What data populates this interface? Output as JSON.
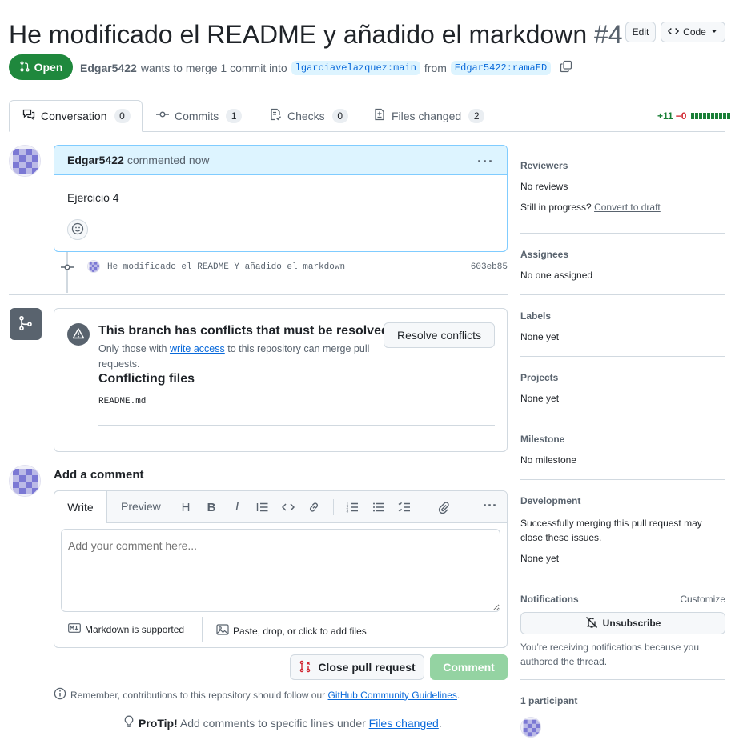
{
  "pr": {
    "title": "He modificado el README y añadido el markdown",
    "number": "#4",
    "edit_label": "Edit",
    "code_label": "Code",
    "state_label": "Open",
    "author": "Edgar5422",
    "merge_text": "wants to merge 1 commit into",
    "base_branch": "lgarciavelazquez:main",
    "from_text": "from",
    "head_branch": "Edgar5422:ramaED"
  },
  "tabs": [
    {
      "label": "Conversation",
      "count": "0"
    },
    {
      "label": "Commits",
      "count": "1"
    },
    {
      "label": "Checks",
      "count": "0"
    },
    {
      "label": "Files changed",
      "count": "2"
    }
  ],
  "diffstat": {
    "additions": "+11",
    "deletions": "−0",
    "blocks": [
      "green",
      "green",
      "green",
      "green",
      "green",
      "green",
      "green",
      "green",
      "green",
      "green"
    ]
  },
  "comment": {
    "author": "Edgar5422",
    "meta": "commented now",
    "body": "Ejercicio 4"
  },
  "commit": {
    "message": "He modificado el README Y añadido el markdown",
    "sha": "603eb85"
  },
  "merge_box": {
    "conflict_title": "This branch has conflicts that must be resolved",
    "conflict_desc_pre": "Only those with",
    "conflict_link": "write access",
    "conflict_desc_post": "to this repository can merge pull requests.",
    "resolve_label": "Resolve conflicts",
    "files_heading": "Conflicting files",
    "files": [
      "README.md"
    ]
  },
  "add_comment": {
    "heading": "Add a comment",
    "tab_write": "Write",
    "tab_preview": "Preview",
    "placeholder": "Add your comment here...",
    "markdown_note": "Markdown is supported",
    "attach_note": "Paste, drop, or click to add files",
    "close_pr_label": "Close pull request",
    "comment_label": "Comment"
  },
  "footer": {
    "guidelines_pre": "Remember, contributions to this repository should follow our",
    "guidelines_link": "GitHub Community Guidelines",
    "guidelines_post": ".",
    "protip_label": "ProTip!",
    "protip_pre": "Add comments to specific lines under",
    "protip_link": "Files changed",
    "protip_post": "."
  },
  "sidebar": {
    "reviewers_heading": "Reviewers",
    "reviewers_value": "No reviews",
    "in_progress": "Still in progress?",
    "convert_draft": "Convert to draft",
    "assignees_heading": "Assignees",
    "assignees_value": "No one assigned",
    "labels_heading": "Labels",
    "labels_value": "None yet",
    "projects_heading": "Projects",
    "projects_value": "None yet",
    "milestone_heading": "Milestone",
    "milestone_value": "No milestone",
    "development_heading": "Development",
    "development_desc": "Successfully merging this pull request may close these issues.",
    "development_value": "None yet",
    "notifications_heading": "Notifications",
    "customize_label": "Customize",
    "unsubscribe_label": "Unsubscribe",
    "notifications_desc": "You’re receiving notifications because you authored the thread.",
    "participants_heading": "1 participant"
  },
  "colors": {
    "open_green": "#1f883d",
    "link_blue": "#0969da",
    "branch_bg": "#ddf4ff",
    "comment_header_bg": "#ddf4ff",
    "comment_btn_disabled": "#94d3a2",
    "danger_red": "#d1242f"
  }
}
